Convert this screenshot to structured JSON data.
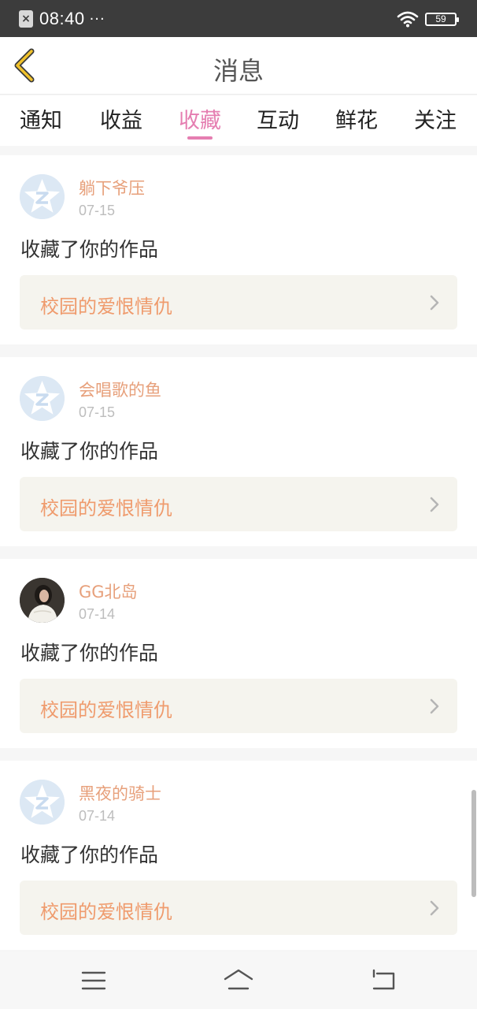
{
  "status_bar": {
    "time": "08:40",
    "dots": "···",
    "notification_icon": "close-box-icon",
    "wifi_icon": "wifi-icon",
    "battery": "59"
  },
  "header": {
    "title": "消息",
    "back_icon": "chevron-left-icon"
  },
  "tabs": [
    {
      "label": "通知",
      "active": false
    },
    {
      "label": "收益",
      "active": false
    },
    {
      "label": "收藏",
      "active": true
    },
    {
      "label": "互动",
      "active": false
    },
    {
      "label": "鲜花",
      "active": false
    },
    {
      "label": "关注",
      "active": false
    }
  ],
  "items": [
    {
      "username": "躺下爷压",
      "date": "07-15",
      "action": "收藏了你的作品",
      "work_title": "校园的爱恨情仇",
      "avatar": "default-star-avatar"
    },
    {
      "username": "会唱歌的鱼",
      "date": "07-15",
      "action": "收藏了你的作品",
      "work_title": "校园的爱恨情仇",
      "avatar": "default-star-avatar"
    },
    {
      "username": "GG北岛",
      "date": "07-14",
      "action": "收藏了你的作品",
      "work_title": "校园的爱恨情仇",
      "avatar": "photo-avatar"
    },
    {
      "username": "黑夜的骑士",
      "date": "07-14",
      "action": "收藏了你的作品",
      "work_title": "校园的爱恨情仇",
      "avatar": "default-star-avatar"
    }
  ],
  "colors": {
    "accent_pink": "#e57eb1",
    "username_orange": "#e7a07b",
    "work_title_orange": "#ef9b6d",
    "link_bg": "#f5f4ee",
    "status_bar_bg": "#3c3c3c"
  },
  "nav_bar": {
    "menu_icon": "menu-icon",
    "home_icon": "home-icon",
    "back_icon": "return-icon"
  }
}
